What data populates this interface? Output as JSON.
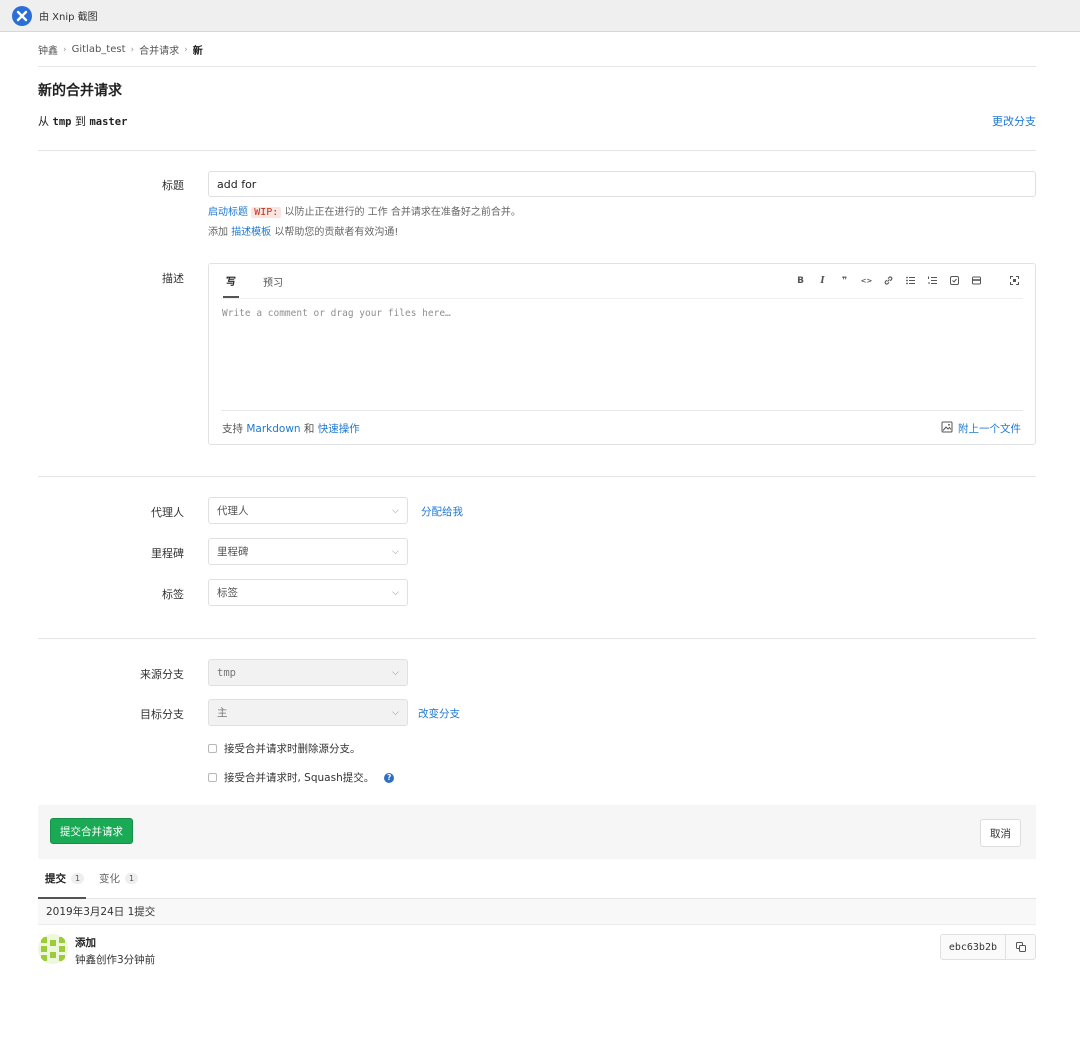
{
  "window": {
    "title": "由 Xnip 截图"
  },
  "breadcrumb": {
    "items": [
      "钟鑫",
      "Gitlab_test",
      "合并请求"
    ],
    "current": "新"
  },
  "page": {
    "title": "新的合并请求"
  },
  "branches": {
    "from_label": "从",
    "source": "tmp",
    "to_label": "到",
    "target": "master",
    "change_link": "更改分支"
  },
  "title_field": {
    "label": "标题",
    "value": "add for",
    "wip_hint_link": "启动标题",
    "wip_tag": "WIP:",
    "wip_hint_rest": " 以防止正在进行的 工作 合并请求在准备好之前合并。",
    "template_prefix": "添加 ",
    "template_link": "描述模板",
    "template_rest": " 以帮助您的贡献者有效沟通!"
  },
  "description": {
    "label": "描述",
    "tab_write": "写",
    "tab_preview": "预习",
    "placeholder": "Write a comment or drag your files here…",
    "markdown_prefix": "支持 ",
    "markdown_link": "Markdown",
    "markdown_mid": " 和 ",
    "quick_actions_link": "快速操作",
    "attach_label": "附上一个文件",
    "toolbar_bold": "B",
    "toolbar_italic": "I",
    "toolbar_quote": "❞",
    "toolbar_code": "<>"
  },
  "assignee": {
    "label": "代理人",
    "value": "代理人",
    "assign_me": "分配给我"
  },
  "milestone": {
    "label": "里程碑",
    "value": "里程碑"
  },
  "labels": {
    "label": "标签",
    "value": "标签"
  },
  "source_branch": {
    "label": "来源分支",
    "value": "tmp"
  },
  "target_branch": {
    "label": "目标分支",
    "value": "主",
    "change_link": "改变分支"
  },
  "options": {
    "delete_source": "接受合并请求时删除源分支。",
    "squash": "接受合并请求时, Squash提交。"
  },
  "actions": {
    "submit": "提交合并请求",
    "cancel": "取消"
  },
  "commit_tabs": [
    {
      "label": "提交",
      "count": "1"
    },
    {
      "label": "变化",
      "count": "1"
    }
  ],
  "commit_day": "2019年3月24日 1提交",
  "commit": {
    "title": "添加",
    "meta": "钟鑫创作3分钟前",
    "sha": "ebc63b2b"
  },
  "colors": {
    "link": "#1f78d1",
    "submit": "#1aaa55",
    "help_icon": "#2e6fc3"
  }
}
